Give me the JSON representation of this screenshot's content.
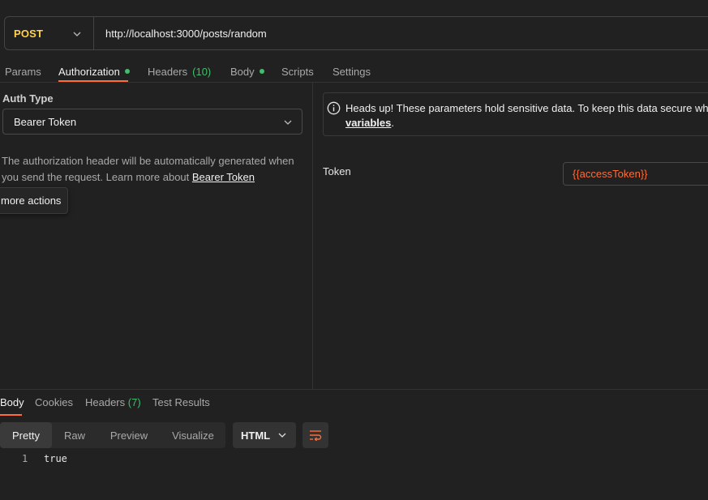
{
  "request": {
    "method": "POST",
    "url": "http://localhost:3000/posts/random"
  },
  "request_tabs": [
    {
      "label": "Params"
    },
    {
      "label": "Authorization",
      "dot": true
    },
    {
      "label": "Headers",
      "count": "(10)"
    },
    {
      "label": "Body",
      "dot": true
    },
    {
      "label": "Scripts"
    },
    {
      "label": "Settings"
    }
  ],
  "auth": {
    "type_label": "Auth Type",
    "type_value": "Bearer Token",
    "description": "The authorization header will be automatically generated when you send the request. Learn more about ",
    "link_text": "Bearer Token",
    "tooltip": "more actions"
  },
  "warning": {
    "line1": "Heads up! These parameters hold sensitive data. To keep this data secure while",
    "link": "variables",
    "suffix": "."
  },
  "token": {
    "label": "Token",
    "value": "{{accessToken}}"
  },
  "response_tabs": [
    {
      "label": "Body"
    },
    {
      "label": "Cookies"
    },
    {
      "label": "Headers",
      "count": "(7)"
    },
    {
      "label": "Test Results"
    }
  ],
  "view_modes": [
    "Pretty",
    "Raw",
    "Preview",
    "Visualize"
  ],
  "format": "HTML",
  "code": {
    "line": "1",
    "text": "true"
  },
  "colors": {
    "accent": "#ff6c37",
    "method": "#ffd24a",
    "count": "#3fbf6a"
  },
  "icons": [
    "chevron-down-icon",
    "info-icon",
    "wrap-lines-icon"
  ]
}
